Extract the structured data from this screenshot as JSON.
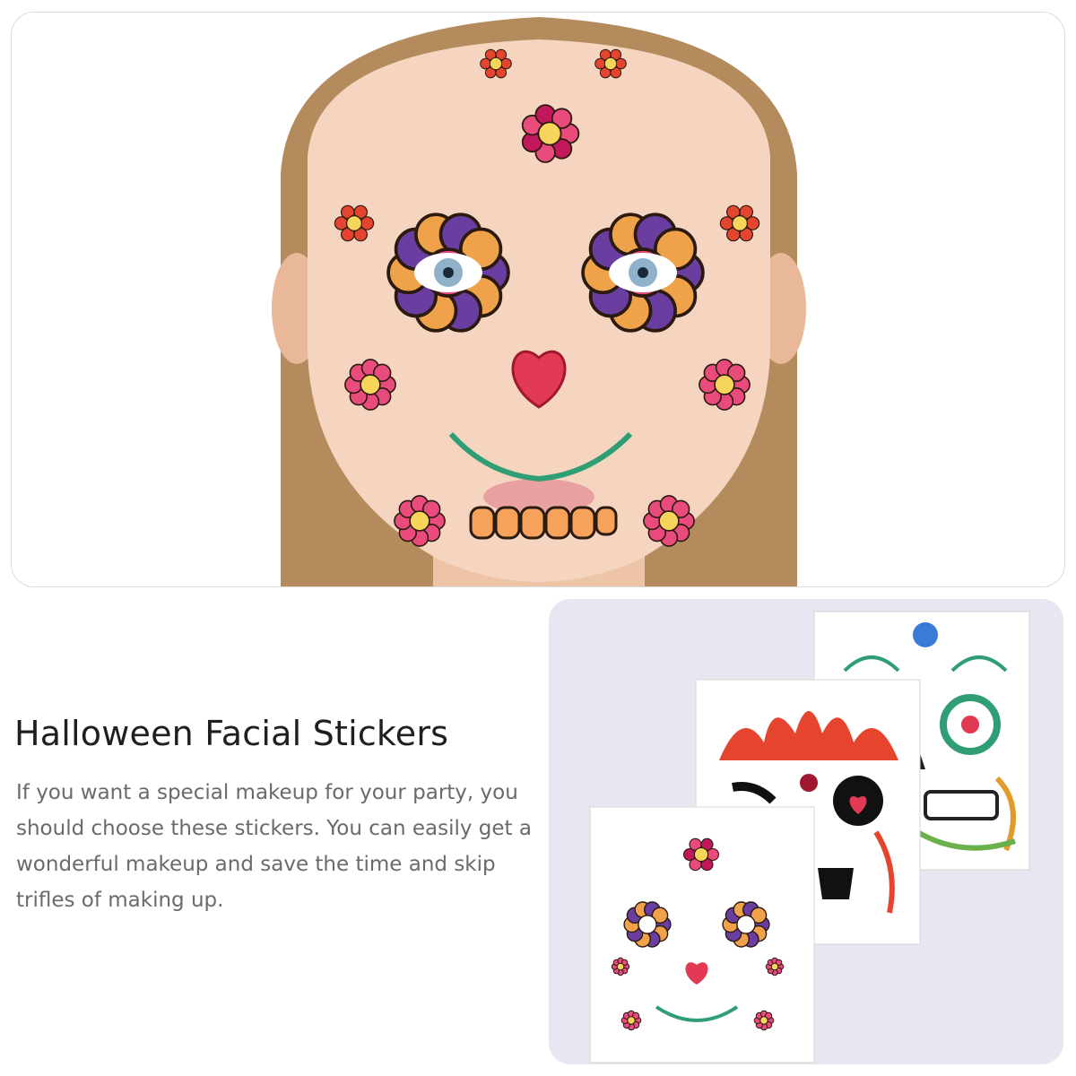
{
  "product": {
    "title": "Halloween Facial Stickers",
    "description": "If you want a special makeup for your party, you should choose these stickers. You can easily get a wonderful makeup and save the time and skip trifles of making up."
  },
  "images": {
    "face_photo": "model-face-with-floral-sugar-skull-stickers",
    "sticker_sheets": [
      "floral-sugar-skull-sheet",
      "red-flame-skull-sheet",
      "sugar-skull-teeth-sheet"
    ]
  },
  "colors": {
    "card_border": "#dcdcdc",
    "card_bg": "#e7e7f1",
    "title_text": "#1f1f1f",
    "body_text": "#6a6a6a"
  }
}
